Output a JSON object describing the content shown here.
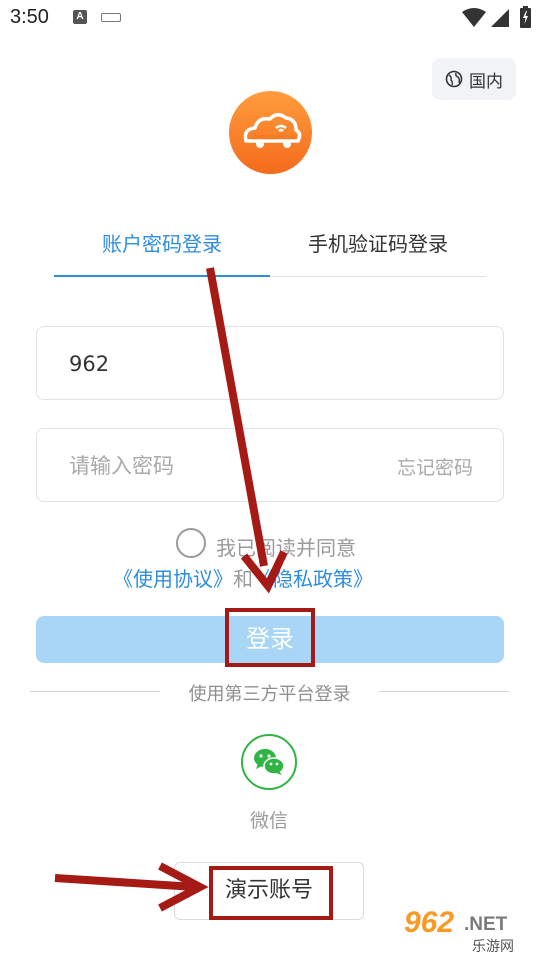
{
  "status_bar": {
    "time": "3:50",
    "notification_icon_letter": "A",
    "icons": [
      "notification-a-icon",
      "keyboard-icon",
      "wifi-icon",
      "signal-icon",
      "battery-icon"
    ]
  },
  "header": {
    "region_label": "国内",
    "region_icon": "globe-icon",
    "logo_icon": "cloud-car-logo"
  },
  "tabs": [
    {
      "label": "账户密码登录",
      "active": true
    },
    {
      "label": "手机验证码登录",
      "active": false
    }
  ],
  "form": {
    "account_value": "962",
    "password_placeholder": "请输入密码",
    "forgot_label": "忘记密码",
    "agree_label": "我已阅读并同意",
    "user_agreement_link": "《使用协议》",
    "and_text": "和",
    "privacy_link": "《隐私政策》",
    "login_label": "登录"
  },
  "third_party": {
    "divider_label": "使用第三方平台登录",
    "wechat_label": "微信",
    "demo_label": "演示账号"
  },
  "watermark": {
    "number": "962",
    "suffix": ".NET",
    "subtitle": "乐游网"
  },
  "colors": {
    "accent": "#2e8ddd",
    "login_button": "#a9d5f7",
    "logo_orange": "#f57c24",
    "wechat_green": "#2fb544",
    "annotation_red": "#a61a16"
  }
}
